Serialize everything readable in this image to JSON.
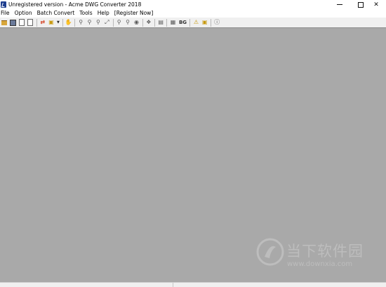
{
  "window": {
    "title": "Unregistered version - Acme DWG Converter 2018",
    "controls": {
      "minimize": "minimize",
      "maximize": "maximize",
      "close": "✕"
    }
  },
  "menu": {
    "items": [
      "File",
      "Option",
      "Batch Convert",
      "Tools",
      "Help",
      "[Register Now]"
    ]
  },
  "toolbar": {
    "bg_label": "BG",
    "icons": [
      "open-folder-icon",
      "save-icon",
      "save-as-icon",
      "print-icon",
      "convert-icon",
      "batch-icon",
      "dropdown-arrow-icon",
      "pan-icon",
      "zoom-in-icon",
      "zoom-out-icon",
      "zoom-window-icon",
      "zoom-extents-icon",
      "zoom-realtime-icon",
      "zoom-previous-icon",
      "view-icon",
      "layer-icon",
      "block-icon",
      "background-icon",
      "warning-icon",
      "layout-icon",
      "about-icon"
    ]
  },
  "watermark": {
    "title": "当下软件园",
    "url": "www.downxia.com"
  },
  "colors": {
    "canvas": "#a9a9a9",
    "chrome": "#f0f0f0",
    "watermark": "#bdbdbd"
  }
}
